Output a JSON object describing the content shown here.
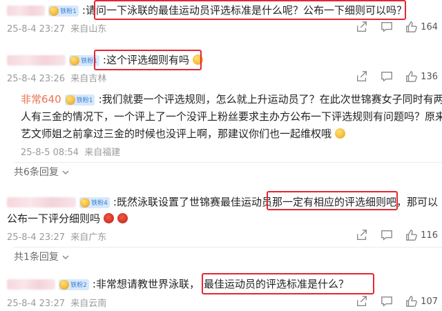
{
  "comments": [
    {
      "user": "",
      "level": "铁粉1",
      "text": ":请问一下泳联的最佳运动员评选标准是什么呢？公布一下细则可以吗？",
      "date": "25-8-4 23:27",
      "loc": "来自山东",
      "likes": "164"
    },
    {
      "user": "",
      "level": "铁粉1",
      "text": ":这个评选细则有吗",
      "date": "25-8-4 23:26",
      "loc": "来自吉林",
      "likes": "136"
    },
    {
      "user": "非常640",
      "level": "铁粉1",
      "text1": ":我们就要一个评选规则，怎么就上升运动员了？在此次世锦赛女子同时有两个",
      "text2": "人有三金的情况下，一个评上了一个没评上粉丝要求主办方公布一下评选规则有问题吗？原来",
      "text3": "艺文师姐之前拿过三金的时候也没评上啊，那建议你们也一起维权哦",
      "date": "25-8-5 08:54",
      "loc": "来自福建",
      "replies": "共6条回复"
    },
    {
      "user": "",
      "level": "铁粉4",
      "text1a": ":既然泳联设置了世锦赛最佳运动员",
      "text1b": "那一定有相应的评选细则吧",
      "text1c": "，那可以",
      "text2": "公布一下评分细则吗",
      "date": "25-8-4 23:27",
      "loc": "来自广东",
      "likes": "116",
      "replies": "共1条回复"
    },
    {
      "user": "",
      "level": "铁粉2",
      "texta": ":非常想请教世界泳联，",
      "textb": "最佳运动员的评选标准是什么？",
      "date": "25-8-4 23:27",
      "loc": "来自云南",
      "likes": "107"
    }
  ]
}
